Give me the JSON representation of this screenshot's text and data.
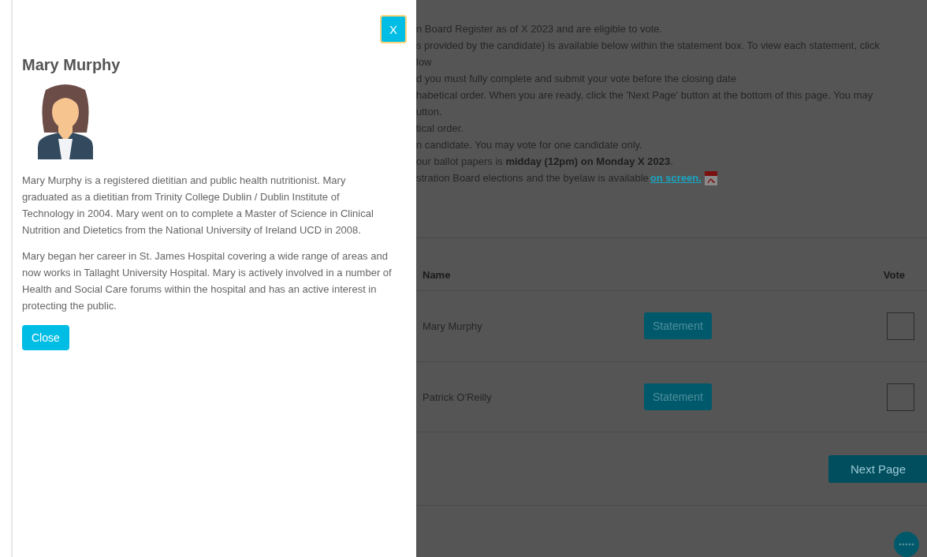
{
  "drawer": {
    "close_icon_button": "X",
    "title": "Mary Murphy",
    "paragraphs": [
      "Mary Murphy is a registered dietitian and public health nutritionist. Mary graduated as a dietitian from Trinity College Dublin / Dublin Institute of Technology in 2004. Mary went on to complete a Master of Science in Clinical Nutrition and Dietetics from the National University of Ireland UCD in 2008.",
      "Mary began her career in St. James Hospital covering a wide range of areas and now works in Tallaght University Hospital. Mary is actively involved in a number of Health and Social Care forums within the hospital and has an active interest in protecting the public."
    ],
    "close_button": "Close"
  },
  "page": {
    "instructions": [
      {
        "text": "n Board Register as of X 2023 and are eligible to vote."
      },
      {
        "text": "s provided by the candidate) is available below within the statement box. To view each statement, click"
      },
      {
        "text": "low"
      },
      {
        "text": "d you must fully complete and submit your vote before the closing date"
      },
      {
        "text": "habetical order. When you are ready, click the 'Next Page' button at the bottom of this page. You may"
      },
      {
        "text": "utton."
      },
      {
        "text": "tical order."
      },
      {
        "text": "n candidate. You may vote for one candidate only."
      },
      {
        "text": "our ballot papers is **midday (12pm) on Monday X 2023**."
      },
      {
        "text": "stration Board elections and the byelaw is available",
        "link": "on screen."
      }
    ],
    "table": {
      "columns": [
        "Name",
        "Vote"
      ],
      "rows": [
        {
          "name": "Mary Murphy",
          "button": "Statement",
          "checked": false
        },
        {
          "name": "Patrick O'Reilly",
          "button": "Statement",
          "checked": false
        }
      ]
    },
    "next_button": "Next Page"
  }
}
